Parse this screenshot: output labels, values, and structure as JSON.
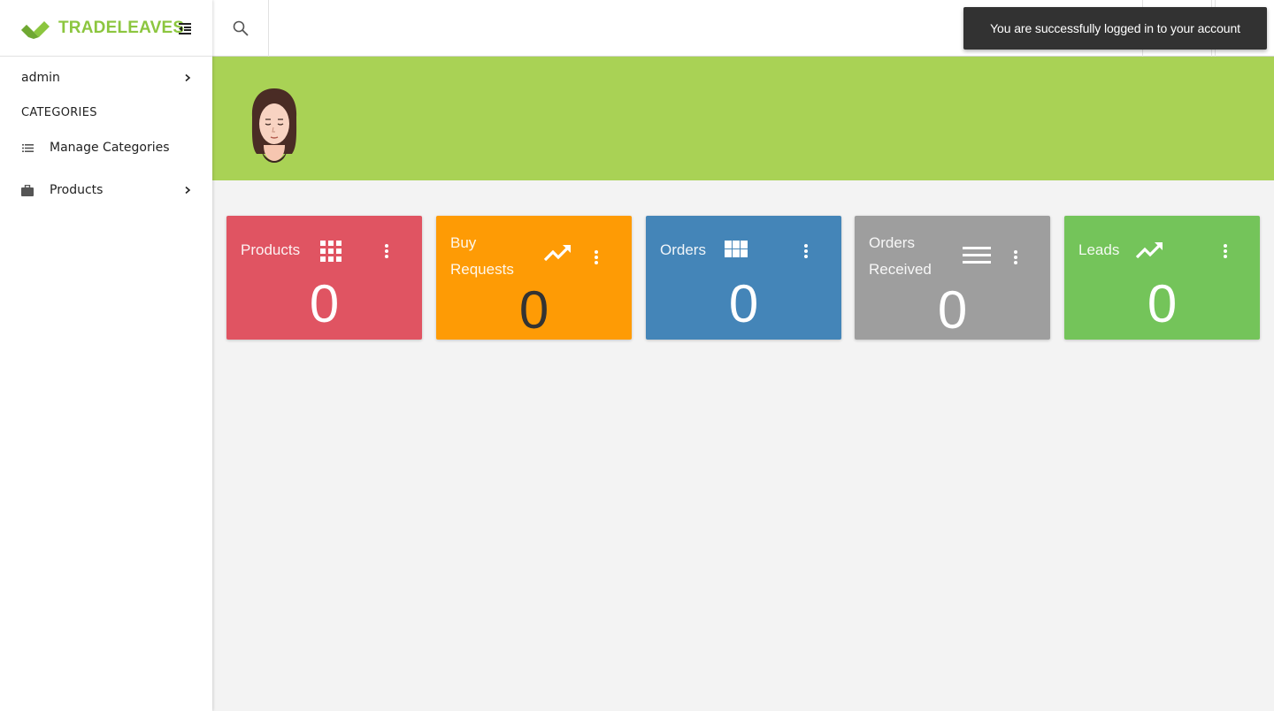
{
  "brand": {
    "name_part1": "TRADE",
    "name_part2": "LEAVES",
    "logo_icon": "leaf-chevron-logo",
    "toggle_icon": "menu-collapse-icon"
  },
  "sidebar": {
    "user_label": "admin",
    "section_heading": "CATEGORIES",
    "items": [
      {
        "label": "Manage Categories",
        "icon": "list-icon",
        "has_submenu": false
      },
      {
        "label": "Products",
        "icon": "briefcase-icon",
        "has_submenu": true
      }
    ]
  },
  "topbar": {
    "search_icon": "search-icon"
  },
  "toast": {
    "message": "You are successfully logged in to your account"
  },
  "banner": {
    "avatar": "user-avatar"
  },
  "cards": [
    {
      "title": "Products",
      "count": "0",
      "icon": "grid-icon",
      "color": "#e05462"
    },
    {
      "title_line1": "Buy",
      "title_line2": "Requests",
      "count": "0",
      "icon": "trending-up-icon",
      "color": "#fe9b05"
    },
    {
      "title": "Orders",
      "count": "0",
      "icon": "view-module-icon",
      "color": "#4485b8"
    },
    {
      "title_line1": "Orders",
      "title_line2": "Received",
      "count": "0",
      "icon": "list-lines-icon",
      "color": "#9e9e9e"
    },
    {
      "title": "Leads",
      "count": "0",
      "icon": "trending-up-icon",
      "color": "#74c45a"
    }
  ],
  "colors": {
    "brand_green": "#8cc63f",
    "banner_green": "#a9d255",
    "toast_bg": "#323232"
  }
}
